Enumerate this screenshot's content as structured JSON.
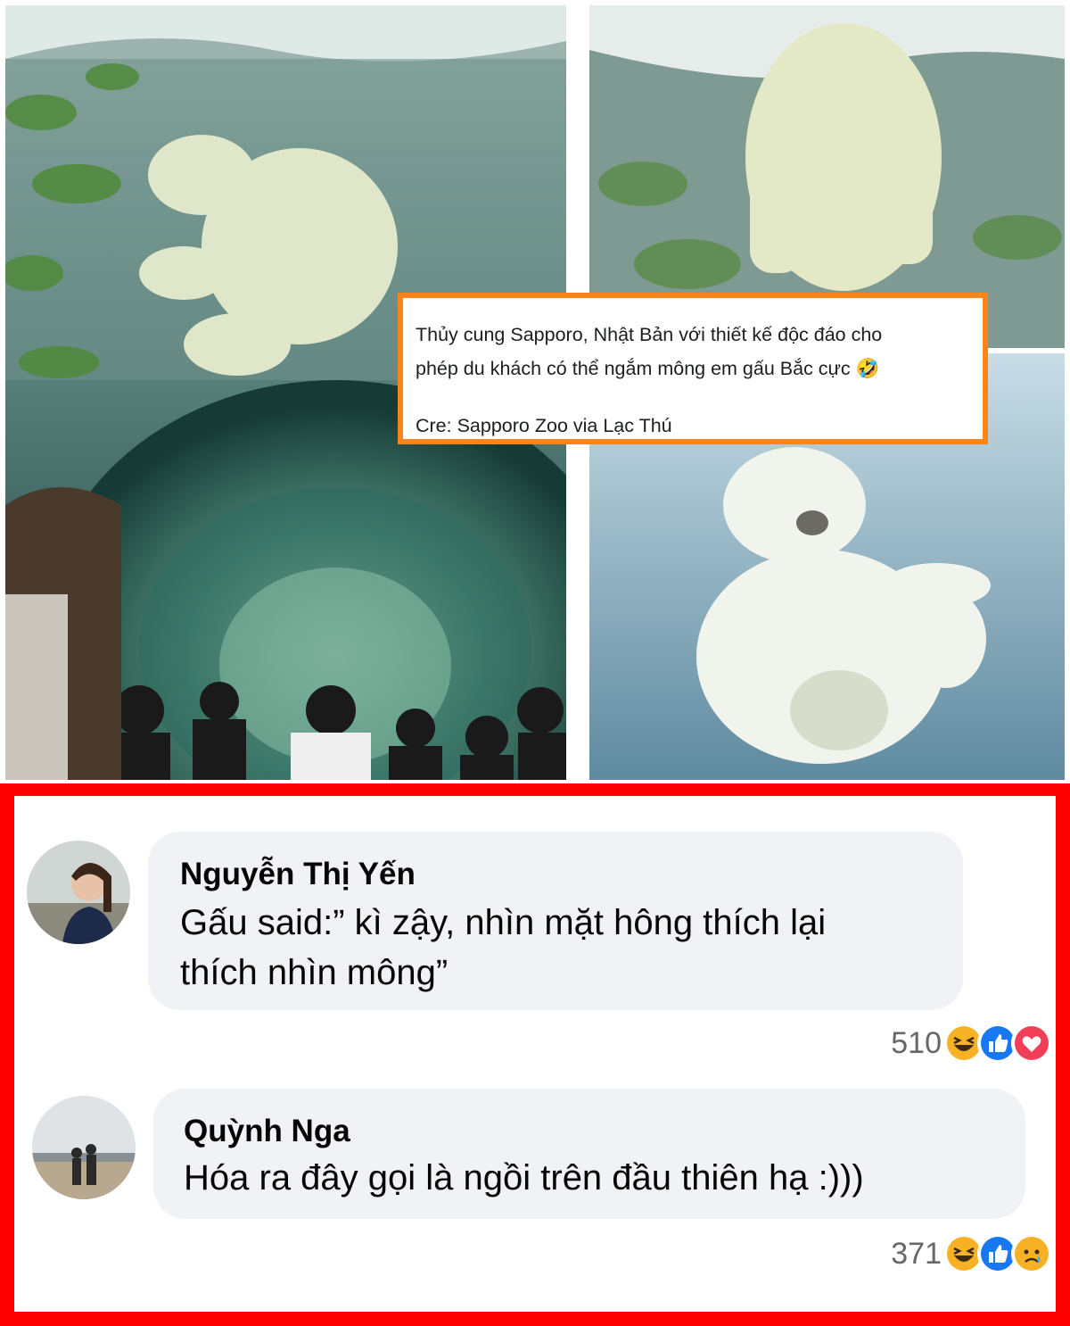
{
  "caption": {
    "line1": "Thủy cung Sapporo, Nhật Bản với thiết kế độc đáo cho",
    "line2": "phép du khách có thể ngắm mông em gấu Bắc cực 🤣",
    "credit": "Cre: Sapporo Zoo via Lạc Thú"
  },
  "comments": [
    {
      "author": "Nguyễn Thị Yến",
      "text_line1": "Gấu said:” kì zậy, nhìn mặt hông thích lại",
      "text_line2": "thích nhìn mông”",
      "reaction_count": "510",
      "reactions": [
        "haha-icon",
        "like-icon",
        "love-icon"
      ]
    },
    {
      "author": "Quỳnh Nga",
      "text_line1": "Hóa ra đây gọi là ngồi trên đầu thiên hạ :)))",
      "reaction_count": "371",
      "reactions": [
        "haha-icon",
        "like-icon",
        "sad-icon"
      ]
    }
  ],
  "colors": {
    "caption_border": "#f7851b",
    "panel_border": "#ff0000",
    "bubble": "#f0f2f5",
    "like_blue": "#1877f2",
    "love_red": "#f33e58",
    "haha_yellow": "#f7b125"
  }
}
